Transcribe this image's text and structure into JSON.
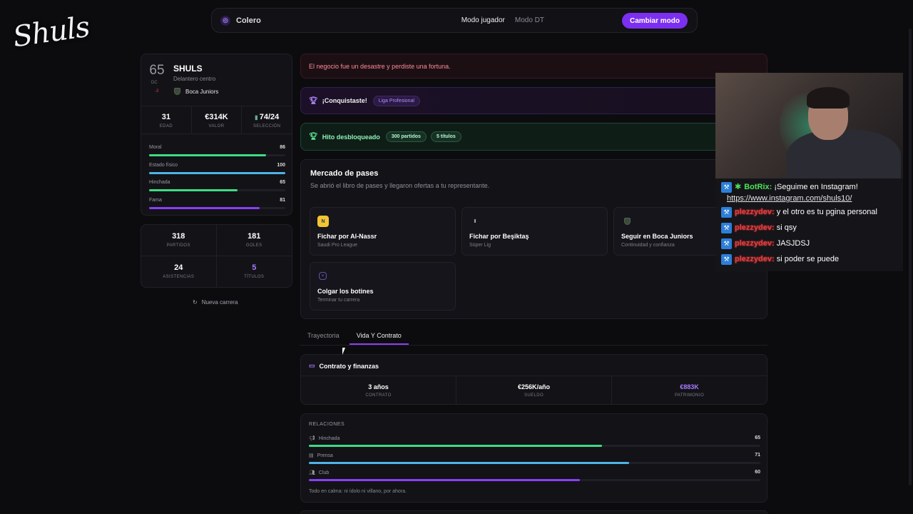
{
  "logo": "Shuls",
  "topnav": {
    "brand": "Colero",
    "modes": [
      "Modo jugador",
      "Modo DT"
    ],
    "active_mode": "Modo jugador",
    "button": "Cambiar modo"
  },
  "profile": {
    "overall": "65",
    "position": "DC",
    "delta": "-3",
    "name": "SHULS",
    "role": "Delantero centro",
    "club": "Boca Juniors",
    "stats": [
      {
        "value": "31",
        "label": "EDAD"
      },
      {
        "value": "€314K",
        "label": "VALOR"
      },
      {
        "value": "74/24",
        "label": "SELECCIÓN"
      }
    ],
    "bars": [
      {
        "label": "Moral",
        "value": "86",
        "pct": 0.86,
        "color": "#3ddc84"
      },
      {
        "label": "Estado físico",
        "value": "100",
        "pct": 1.0,
        "color": "#4fb3e8"
      },
      {
        "label": "Hinchada",
        "value": "65",
        "pct": 0.65,
        "color": "#3ddc84"
      },
      {
        "label": "Fama",
        "value": "81",
        "pct": 0.81,
        "color": "#8b3ff5"
      }
    ]
  },
  "career_stats": [
    {
      "value": "318",
      "label": "PARTIDOS",
      "accent": false
    },
    {
      "value": "181",
      "label": "GOLES",
      "accent": false
    },
    {
      "value": "24",
      "label": "ASISTENCIAS",
      "accent": false
    },
    {
      "value": "5",
      "label": "TÍTULOS",
      "accent": true
    }
  ],
  "new_career": "Nueva carrera",
  "banners": {
    "red": "El negocio fue un desastre y perdiste una fortuna.",
    "purple": {
      "text": "¡Conquistaste!",
      "pill": "Liga Profesional"
    },
    "green": {
      "text": "Hito desbloqueado",
      "pills": [
        "300 partidos",
        "5 títulos"
      ]
    }
  },
  "market": {
    "title": "Mercado de pases",
    "subtitle": "Se abrió el libro de pases y llegaron ofertas a tu representante.",
    "options": [
      {
        "title": "Fichar por Al-Nassr",
        "sub": "Saudi Pro League",
        "icon": "al-nassr-crest"
      },
      {
        "title": "Fichar por Beşiktaş",
        "sub": "Süper Lig",
        "icon": "besiktas-crest"
      },
      {
        "title": "Seguir en Boca Juniors",
        "sub": "Continuidad y confianza",
        "icon": "boca-crest"
      },
      {
        "title": "Colgar los botines",
        "sub": "Terminar tu carrera",
        "icon": "retire-icon"
      }
    ]
  },
  "tabs": [
    "Trayectoria",
    "Vida Y Contrato"
  ],
  "active_tab": "Vida Y Contrato",
  "contract": {
    "title": "Contrato y finanzas",
    "items": [
      {
        "value": "3 años",
        "label": "CONTRATO"
      },
      {
        "value": "€256K/año",
        "label": "SUELDO"
      },
      {
        "value": "€883K",
        "label": "PATRIMONIO"
      }
    ]
  },
  "relations": {
    "title": "RELACIONES",
    "items": [
      {
        "label": "Hinchada",
        "value": "65",
        "pct": 0.65,
        "color": "#3ddc84"
      },
      {
        "label": "Prensa",
        "value": "71",
        "pct": 0.71,
        "color": "#4fb3e8"
      },
      {
        "label": "Club",
        "value": "60",
        "pct": 0.6,
        "color": "#8b3ff5"
      }
    ],
    "note": "Todo en calma: ni ídolo ni villano, por ahora."
  },
  "chat": [
    {
      "user": "BotRix:",
      "text": "¡Seguime en Instagram!",
      "link": "https://www.instagram.com/shuls10/",
      "bot": true
    },
    {
      "user": "plezzydev:",
      "text": "y el otro es tu pgina personal"
    },
    {
      "user": "plezzydev:",
      "text": "si qsy"
    },
    {
      "user": "plezzydev:",
      "text": "JASJDSJ"
    },
    {
      "user": "plezzydev:",
      "text": "si poder se puede"
    }
  ]
}
